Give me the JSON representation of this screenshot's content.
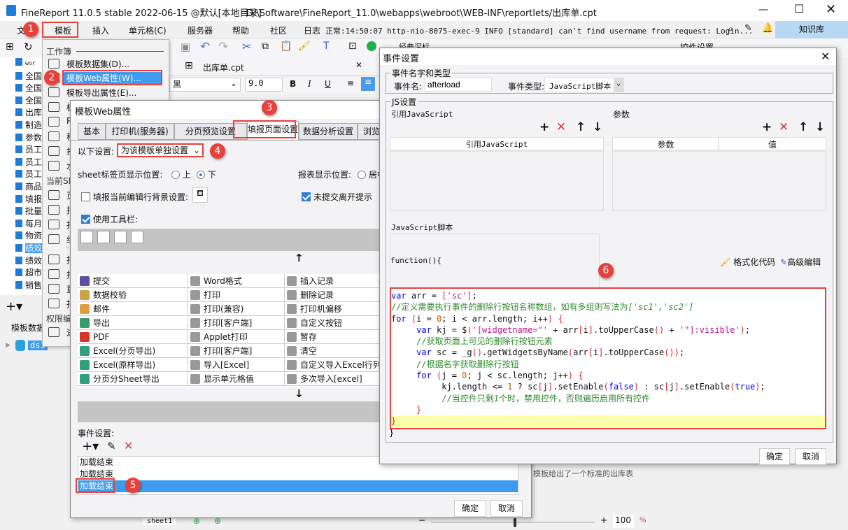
{
  "window": {
    "title": "FineReport 11.0.5 stable 2022-06-15 @默认[本地目录]",
    "path": "D:\\Software\\FineReport_11.0\\webapps\\webroot\\WEB-INF\\reportlets/出库单.cpt"
  },
  "menu": {
    "items": [
      "文件",
      "模板",
      "插入",
      "单元格(C)",
      "服务器",
      "帮助",
      "社区",
      "日志"
    ],
    "log": "正常:14:50:07 http-nio-8075-exec-9 INFO [standard] can't find username from request: Login...",
    "knowledge": "知识库"
  },
  "toolbar": {
    "tab_file": "出库单.cpt",
    "font": "黑",
    "font_size": "9.0",
    "classic": "经典深标",
    "widget_settings": "控件设置"
  },
  "tree": {
    "items": [
      "wor",
      "全国",
      "全国",
      "全国",
      "出库",
      "制造",
      "参数",
      "员工",
      "员工",
      "员工",
      "商品",
      "填报",
      "批量",
      "每月",
      "物资",
      "绩效",
      "绩效",
      "超市",
      "销售"
    ],
    "selected": 15,
    "dataset_header": "模板数据集",
    "dataset": "ds1"
  },
  "dropdown": {
    "header_workbook": "工作簿",
    "items": [
      "模板数据集(D)...",
      "模板Web属性(W)...",
      "模板导出属性(E)...",
      "模",
      "PC",
      "移",
      "打",
      "水"
    ],
    "header_sheet": "当前Sheet",
    "sheet_items": [
      "页",
      "报",
      "报",
      "纸",
      "报",
      "报",
      "重",
      "报"
    ],
    "header_perm": "权限编辑",
    "perm_items": [
      "进"
    ]
  },
  "badges": [
    "1",
    "2",
    "3",
    "4",
    "5",
    "6"
  ],
  "webdlg": {
    "title": "模板Web属性",
    "tabs": [
      "基本",
      "打印机(服务器)",
      "分页预览设置",
      "填报页面设置",
      "数据分析设置",
      "浏览"
    ],
    "settings_label": "以下设置:",
    "settings_value": "为该模板单独设置",
    "sheet_pos_label": "sheet标签页显示位置:",
    "sheet_pos_options": [
      "上",
      "下"
    ],
    "report_pos_label": "报表显示位置:",
    "report_pos_option": "居中",
    "row_bg_label": "填报当前编辑行背景设置:",
    "leave_prompt": "未提交离开提示",
    "use_toolbar": "使用工具栏:",
    "buttons": [
      [
        "提交",
        "Word格式",
        "插入记录"
      ],
      [
        "数据校验",
        "打印",
        "删除记录"
      ],
      [
        "邮件",
        "打印(兼容)",
        "打印机偏移"
      ],
      [
        "导出",
        "打印[客户端]",
        "自定义按钮"
      ],
      [
        "PDF",
        "Applet打印",
        "暂存"
      ],
      [
        "Excel(分页导出)",
        "打印[客户端]",
        "清空"
      ],
      [
        "Excel(原样导出)",
        "导入[Excel]",
        "自定义导入Excel行列"
      ],
      [
        "分页分Sheet导出",
        "显示单元格值",
        "多次导入[excel]"
      ]
    ],
    "event_label": "事件设置:",
    "events": [
      "加载结束",
      "加载结束",
      "加载结束"
    ],
    "ok": "确定",
    "cancel": "取消"
  },
  "evdlg": {
    "title": "事件设置",
    "group_name": "事件名字和类型",
    "name_label": "事件名:",
    "name_value": "afterload",
    "type_label": "事件类型:",
    "type_value": "JavaScript脚本",
    "js_group": "JS设置",
    "ref_js": "引用JavaScript",
    "ref_js_col": "引用JavaScript",
    "params": "参数",
    "param_col": "参数",
    "value_col": "值",
    "script_label": "JavaScript脚本",
    "fn_header": "function(){",
    "format_code": "格式化代码",
    "advanced_edit": "高级编辑",
    "fn_footer": "}",
    "ok": "确定",
    "cancel": "取消",
    "code": [
      [
        [
          "var",
          "kw"
        ],
        [
          " arr = ",
          "pl"
        ],
        [
          "[",
          "br"
        ],
        [
          "'sc'",
          "st"
        ],
        [
          "]",
          "br"
        ],
        [
          ";",
          "pl"
        ]
      ],
      [
        [
          "//定义需要执行事件的删除行按钮名称数组，如有多组则写法为",
          "cm"
        ],
        [
          "['sc1','sc2']",
          "it"
        ]
      ],
      [
        [
          "for",
          "kw"
        ],
        [
          " ",
          "pl"
        ],
        [
          "(",
          "br"
        ],
        [
          "i = ",
          "pl"
        ],
        [
          "0",
          "nm"
        ],
        [
          "; i < arr.length; i++",
          "pl"
        ],
        [
          ")",
          "br"
        ],
        [
          " ",
          "pl"
        ],
        [
          "{",
          "br"
        ]
      ],
      [
        [
          "     var",
          "kw"
        ],
        [
          " kj = $",
          "pl"
        ],
        [
          "(",
          "br"
        ],
        [
          "'[widgetname=\"' ",
          "st"
        ],
        [
          "+ arr",
          "pl"
        ],
        [
          "[",
          "br"
        ],
        [
          "i",
          "pl"
        ],
        [
          "]",
          "br"
        ],
        [
          ".toUpperCase",
          "pl"
        ],
        [
          "()",
          "br"
        ],
        [
          " + ",
          "pl"
        ],
        [
          "'\"]:visible'",
          "st"
        ],
        [
          ")",
          "br"
        ],
        [
          ";",
          "pl"
        ]
      ],
      [
        [
          "     //获取页面上可见的删除行按钮元素",
          "cm"
        ]
      ],
      [
        [
          "     var",
          "kw"
        ],
        [
          " sc = _g",
          "pl"
        ],
        [
          "()",
          "br"
        ],
        [
          ".getWidgetsByName",
          "pl"
        ],
        [
          "(",
          "br"
        ],
        [
          "arr",
          "pl"
        ],
        [
          "[",
          "br"
        ],
        [
          "i",
          "pl"
        ],
        [
          "]",
          "br"
        ],
        [
          ".toUpperCase",
          "pl"
        ],
        [
          "())",
          "br"
        ],
        [
          ";",
          "pl"
        ]
      ],
      [
        [
          "     //根据名字获取删除行按钮",
          "cm"
        ]
      ],
      [
        [
          "     for",
          "kw"
        ],
        [
          " ",
          "pl"
        ],
        [
          "(",
          "br"
        ],
        [
          "j = ",
          "pl"
        ],
        [
          "0",
          "nm"
        ],
        [
          "; j < sc.length; j++",
          "pl"
        ],
        [
          ")",
          "br"
        ],
        [
          " ",
          "pl"
        ],
        [
          "{",
          "br"
        ]
      ],
      [
        [
          "          kj.length <= ",
          "pl"
        ],
        [
          "1",
          "nm"
        ],
        [
          " ? sc",
          "pl"
        ],
        [
          "[",
          "br"
        ],
        [
          "j",
          "pl"
        ],
        [
          "]",
          "br"
        ],
        [
          ".setEnable",
          "pl"
        ],
        [
          "(",
          "br"
        ],
        [
          "false",
          "kw"
        ],
        [
          ")",
          "br"
        ],
        [
          " : sc",
          "pl"
        ],
        [
          "[",
          "br"
        ],
        [
          "j",
          "pl"
        ],
        [
          "]",
          "br"
        ],
        [
          ".setEnable",
          "pl"
        ],
        [
          "(",
          "br"
        ],
        [
          "true",
          "kw"
        ],
        [
          ")",
          "br"
        ],
        [
          ";",
          "pl"
        ]
      ],
      [
        [
          "          //当控件只剩",
          "cm"
        ],
        [
          "1",
          "it"
        ],
        [
          "个时，禁用控件，否则遍历启用所有控件",
          "cm"
        ]
      ],
      [
        [
          "     }",
          "br"
        ]
      ],
      [
        [
          "}",
          "br"
        ]
      ]
    ]
  },
  "status": {
    "sheet": "sheet1",
    "zoom": "100",
    "zoom_unit": "%",
    "hint": "模板给出了一个标准的出库表"
  }
}
